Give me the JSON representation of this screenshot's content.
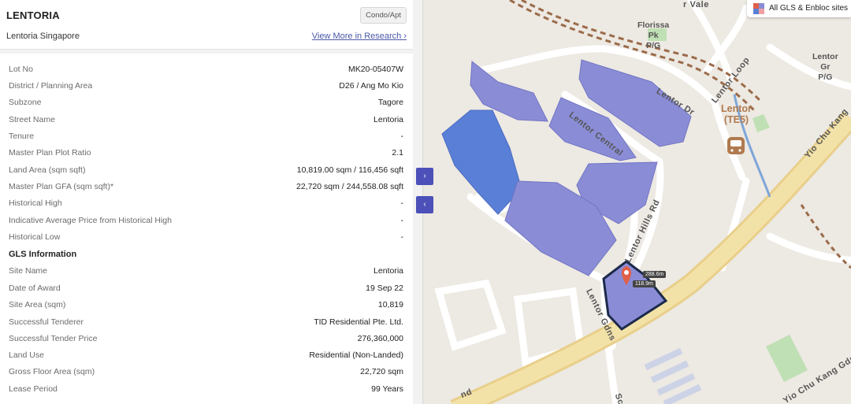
{
  "project": {
    "title": "LENTORIA",
    "subtitle": "Lentoria Singapore",
    "type_badge": "Condo/Apt",
    "research_link": "View More in Research ›"
  },
  "details": {
    "rows": [
      {
        "label": "Lot No",
        "value": "MK20-05407W"
      },
      {
        "label": "District / Planning Area",
        "value": "D26 / Ang Mo Kio"
      },
      {
        "label": "Subzone",
        "value": "Tagore"
      },
      {
        "label": "Street Name",
        "value": "Lentoria"
      },
      {
        "label": "Tenure",
        "value": "-"
      },
      {
        "label": "Master Plan Plot Ratio",
        "value": "2.1"
      },
      {
        "label": "Land Area (sqm sqft)",
        "value": "10,819.00 sqm / 116,456 sqft"
      },
      {
        "label": "Master Plan GFA (sqm sqft)*",
        "value": "22,720 sqm / 244,558.08 sqft"
      },
      {
        "label": "Historical High",
        "value": "-"
      },
      {
        "label": "Indicative Average Price from Historical High",
        "value": "-"
      },
      {
        "label": "Historical Low",
        "value": "-"
      }
    ]
  },
  "gls": {
    "heading": "GLS Information",
    "rows": [
      {
        "label": "Site Name",
        "value": "Lentoria"
      },
      {
        "label": "Date of Award",
        "value": "19 Sep 22"
      },
      {
        "label": "Site Area (sqm)",
        "value": "10,819"
      },
      {
        "label": "Successful Tenderer",
        "value": "TID Residential Pte. Ltd."
      },
      {
        "label": "Successful Tender Price",
        "value": "276,360,000"
      },
      {
        "label": "Land Use",
        "value": "Residential (Non-Landed)"
      },
      {
        "label": "Gross Floor Area (sqm)",
        "value": "22,720 sqm"
      },
      {
        "label": "Lease Period",
        "value": "99 Years"
      }
    ]
  },
  "controls": {
    "expand_glyph": "›",
    "collapse_glyph": "‹"
  },
  "map": {
    "toggle_label": "All GLS & Enbloc sites",
    "mrt_name": "Lentor",
    "mrt_code": "(TE5)",
    "roads": {
      "vale": "r Vale",
      "lentor_central": "Lentor Central",
      "lentor_dr": "Lentor Dr",
      "lentor_loop": "Lentor Loop",
      "lentor_hills": "Lentor Hills Rd",
      "lentor_gdns": "Lentor Gdns",
      "yio_chu_kang": "Yio Chu Kang",
      "yio_chu_kang_gdns": "Yio Chu Kang Gdns",
      "nd": "nd",
      "sc": "Sc",
      "edge": "e"
    },
    "places": {
      "florissa": [
        "Florissa",
        "Pk",
        "P/G"
      ],
      "lentor_gr": [
        "Lentor",
        "Gr",
        "P/G"
      ]
    },
    "distances": [
      "288.6m",
      "118.9m"
    ],
    "colors": {
      "parcel": "#8a8dd6",
      "parcel_dark": "#5a7fd6",
      "selected_outline": "#1c2a4a",
      "marker": "#e0604a",
      "mrt": "#b07a4e",
      "expressway": "#f0dca0"
    }
  }
}
